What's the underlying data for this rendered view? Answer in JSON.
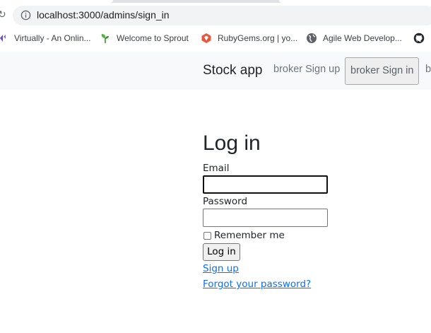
{
  "browser": {
    "url": "localhost:3000/admins/sign_in",
    "bookmarks": [
      {
        "label": "Virtually - An Onlin...",
        "icon": "virtually-icon"
      },
      {
        "label": "Welcome to Sprout",
        "icon": "sprout-icon"
      },
      {
        "label": "RubyGems.org | yo...",
        "icon": "rubygems-icon"
      },
      {
        "label": "Agile Web Develop...",
        "icon": "globe-icon"
      },
      {
        "label": "",
        "icon": "github-icon"
      }
    ]
  },
  "navbar": {
    "brand": "Stock app",
    "links": [
      {
        "label": "broker Sign up",
        "active": false
      },
      {
        "label": "broker Sign in",
        "active": true
      },
      {
        "label": "b",
        "active": false
      }
    ]
  },
  "form": {
    "title": "Log in",
    "email_label": "Email",
    "email_value": "",
    "password_label": "Password",
    "password_value": "",
    "remember_label": "Remember me",
    "remember_checked": false,
    "submit_label": "Log in"
  },
  "links": {
    "sign_up": "Sign up",
    "forgot_password": "Forgot your password?"
  },
  "colors": {
    "navbar_bg": "#f8f9fa",
    "link": "#0d6efd",
    "omnibox_bg": "#f1f3f4"
  }
}
